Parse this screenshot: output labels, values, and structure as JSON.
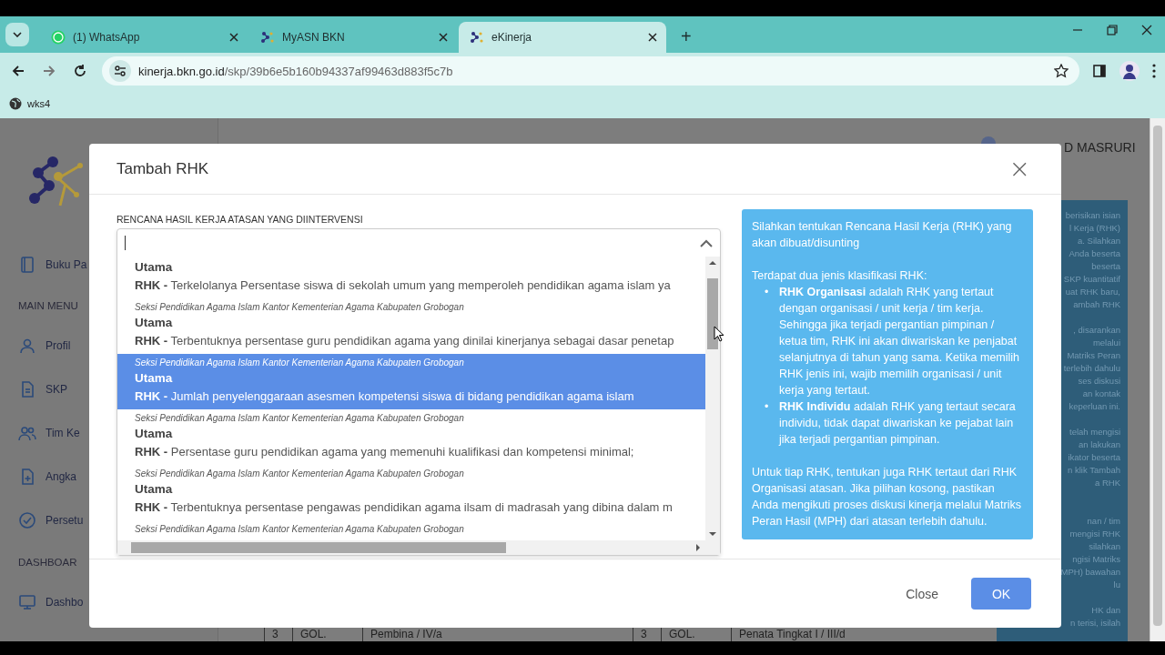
{
  "browser": {
    "tabs": [
      {
        "title": "(1) WhatsApp",
        "selected": false
      },
      {
        "title": "MyASN BKN",
        "selected": false
      },
      {
        "title": "eKinerja",
        "selected": true
      }
    ],
    "new_tab": "+",
    "url": {
      "host": "kinerja.bkn.go.id",
      "path": "/skp/39b6e5b160b94337af99463d883f5c7b"
    },
    "bookmarks": [
      {
        "label": "wks4"
      }
    ]
  },
  "background_page": {
    "sidebar": [
      {
        "kind": "item",
        "label": "Buku Pa"
      },
      {
        "kind": "heading",
        "label": "MAIN MENU"
      },
      {
        "kind": "item",
        "label": "Profil"
      },
      {
        "kind": "item",
        "label": "SKP"
      },
      {
        "kind": "item",
        "label": "Tim Ke"
      },
      {
        "kind": "item",
        "label": "Angka"
      },
      {
        "kind": "item",
        "label": "Persetu"
      },
      {
        "kind": "heading",
        "label": "DASHBOAR"
      },
      {
        "kind": "item",
        "label": "Dashbo"
      }
    ],
    "user_name": "D MASRURI",
    "help_paragraphs": [
      [
        "berisikan isian",
        "l Kerja (RHK)",
        "a. Silahkan",
        "Anda beserta",
        "beserta",
        "SKP kuantitatif",
        "uat RHK baru,",
        "ambah RHK"
      ],
      [
        ", disarankan",
        "melalui",
        "Matriks Peran",
        "terlebih dahulu",
        "ses diskusi",
        "an kontak",
        "keperluan ini."
      ],
      [
        "telah mengisi",
        "an lakukan",
        "ikator beserta",
        "n klik Tambah",
        "a RHK"
      ],
      [
        "nan / tim",
        "mengisi RHK",
        "silahkan",
        "ngisi Matriks",
        "MPH) bawahan",
        "lu"
      ],
      [
        "HK dan",
        "n terisi, isilah"
      ]
    ],
    "table_rows": [
      [
        "3",
        "GOL.",
        "Pembina / IV/a"
      ],
      [
        "3",
        "GOL.",
        "Penata Tingkat I / III/d"
      ]
    ]
  },
  "modal": {
    "title": "Tambah RHK",
    "close_icon": "×",
    "field_label": "RENCANA HASIL KERJA ATASAN YANG DIINTERVENSI",
    "options": [
      {
        "category": "Utama",
        "prefix": "RHK -",
        "text": "Terkelolanya Persentase siswa di sekolah umum yang memperoleh pendidikan agama islam ya",
        "selected": false
      },
      {
        "group": "Seksi Pendidikan Agama Islam Kantor Kementerian Agama Kabupaten Grobogan",
        "category": "Utama",
        "prefix": "RHK -",
        "text": "Terbentuknya persentase guru pendidikan agama yang dinilai kinerjanya sebagai dasar penetap",
        "selected": false
      },
      {
        "group": "Seksi Pendidikan Agama Islam Kantor Kementerian Agama Kabupaten Grobogan",
        "category": "Utama",
        "prefix": "RHK -",
        "text": "Jumlah penyelenggaraan asesmen kompetensi siswa di bidang pendidikan agama islam",
        "selected": true
      },
      {
        "group": "Seksi Pendidikan Agama Islam Kantor Kementerian Agama Kabupaten Grobogan",
        "category": "Utama",
        "prefix": "RHK -",
        "text": "Persentase guru pendidikan agama yang memenuhi kualifikasi dan kompetensi minimal;",
        "selected": false
      },
      {
        "group": "Seksi Pendidikan Agama Islam Kantor Kementerian Agama Kabupaten Grobogan",
        "category": "Utama",
        "prefix": "RHK -",
        "text": "Terbentuknya persentase pengawas pendidikan agama ilsam di madrasah yang dibina dalam m",
        "selected": false
      },
      {
        "group": "Seksi Pendidikan Agama Islam Kantor Kementerian Agama Kabupaten Grobogan"
      }
    ],
    "info": {
      "intro": "Silahkan tentukan Rencana Hasil Kerja (RHK) yang akan dibuat/disunting",
      "lead": "Terdapat dua jenis klasifikasi RHK:",
      "bullet_marker": "•",
      "bullets": [
        "**RHK Organisasi** adalah RHK yang tertaut dengan organisasi / unit kerja / tim kerja. Sehingga jika terjadi pergantian pimpinan / ketua tim, RHK ini akan diwariskan ke penjabat selanjutnya di tahun yang sama. Ketika memilih RHK jenis ini, wajib memilih organisasi / unit kerja yang tertaut.",
        "**RHK Individu** adalah RHK yang tertaut secara individu, tidak dapat diwariskan ke pejabat lain jika terjadi pergantian pimpinan."
      ],
      "outro": "Untuk tiap RHK, tentukan juga RHK tertaut dari RHK Organisasi atasan. Jika pilihan kosong, pastikan Anda mengikuti proses diskusi kinerja melalui Matriks Peran Hasil (MPH) dari atasan terlebih dahulu."
    },
    "buttons": {
      "close": "Close",
      "ok": "OK"
    }
  }
}
